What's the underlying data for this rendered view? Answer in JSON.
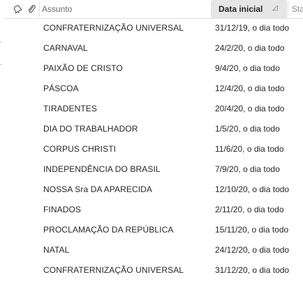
{
  "header": {
    "reminder_icon": "reminder-bell-icon",
    "attachment_icon": "paperclip-icon",
    "subject_label": "Assunto",
    "start_date_label": "Data inicial",
    "sort_icon": "sort-ascending-icon",
    "status_label": "Sta"
  },
  "rows": [
    {
      "subject": "CONFRATERNIZAÇÃO UNIVERSAL",
      "date": "31/12/19, o dia todo"
    },
    {
      "subject": "CARNAVAL",
      "date": "24/2/20, o dia todo"
    },
    {
      "subject": "PAIXÃO DE CRISTO",
      "date": "9/4/20, o dia todo"
    },
    {
      "subject": "PÁSCOA",
      "date": "12/4/20, o dia todo"
    },
    {
      "subject": "TIRADENTES",
      "date": "20/4/20, o dia todo"
    },
    {
      "subject": "DIA DO TRABALHADOR",
      "date": "1/5/20, o dia todo"
    },
    {
      "subject": "CORPUS CHRISTI",
      "date": "11/6/20, o dia todo"
    },
    {
      "subject": "INDEPENDÊNCIA DO BRASIL",
      "date": "7/9/20, o dia todo"
    },
    {
      "subject": "NOSSA Sra DA APARECIDA",
      "date": "12/10/20, o dia todo"
    },
    {
      "subject": "FINADOS",
      "date": "2/11/20, o dia todo"
    },
    {
      "subject": "PROCLAMAÇÃO DA REPÚBLICA",
      "date": "15/11/20, o dia todo"
    },
    {
      "subject": "NATAL",
      "date": "24/12/20, o dia todo"
    },
    {
      "subject": "CONFRATERNIZAÇÃO UNIVERSAL",
      "date": "31/12/20, o dia todo"
    }
  ]
}
